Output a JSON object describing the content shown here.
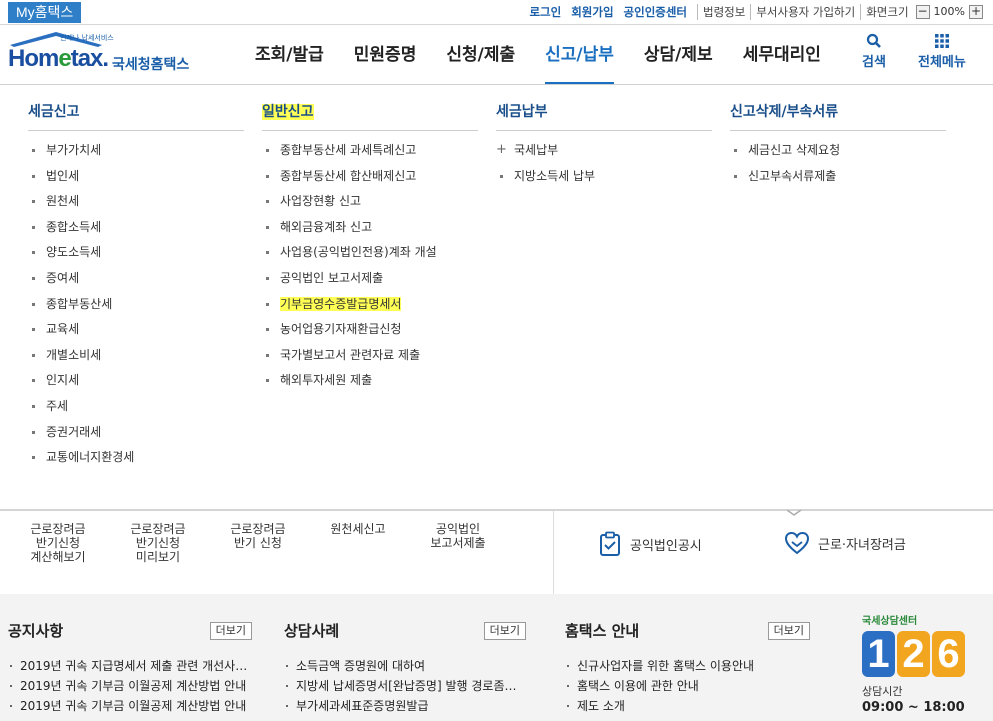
{
  "topbar": {
    "my_hometax": "My홈택스",
    "login": "로그인",
    "signup": "회원가입",
    "cert_center": "공인인증센터",
    "law_info": "법령정보",
    "dept_user_join": "부서사용자 가입하기",
    "screen_size": "화면크기",
    "zoom_minus": "−",
    "zoom_value": "100%",
    "zoom_plus": "+"
  },
  "logo": {
    "tagline": "언제나 납세서비스",
    "brand_pre": "Hom",
    "brand_e": "e",
    "brand_post": "tax.",
    "korean_name": "국세청홈택스"
  },
  "gnb": {
    "items": [
      "조회/발급",
      "민원증명",
      "신청/제출",
      "신고/납부",
      "상담/제보",
      "세무대리인"
    ],
    "active_index": 3,
    "search_label": "검색",
    "all_menu_label": "전체메뉴"
  },
  "dropdown": {
    "col1": {
      "title": "세금신고",
      "items": [
        "부가가치세",
        "법인세",
        "원천세",
        "종합소득세",
        "양도소득세",
        "증여세",
        "종합부동산세",
        "교육세",
        "개별소비세",
        "인지세",
        "주세",
        "증권거래세",
        "교통에너지환경세"
      ]
    },
    "col2": {
      "title": "일반신고",
      "items": [
        "종합부동산세 과세특례신고",
        "종합부동산세 합산배제신고",
        "사업장현황 신고",
        "해외금융계좌 신고",
        "사업용(공익법인전용)계좌 개설",
        "공익법인 보고서제출",
        "기부금영수증발급명세서",
        "농어업용기자재환급신청",
        "국가별보고서 관련자료 제출",
        "해외투자세원 제출"
      ],
      "highlighted_index": 6
    },
    "col3": {
      "title": "세금납부",
      "items": [
        "국세납부",
        "지방소득세 납부"
      ]
    },
    "col4": {
      "title": "신고삭제/부속서류",
      "items": [
        "세금신고 삭제요청",
        "신고부속서류제출"
      ]
    }
  },
  "quick": {
    "items": [
      {
        "l1": "근로장려금",
        "l2": "반기신청",
        "l3": "계산해보기"
      },
      {
        "l1": "근로장려금",
        "l2": "반기신청",
        "l3": "미리보기"
      },
      {
        "l1": "근로장려금",
        "l2": "반기 신청",
        "l3": ""
      },
      {
        "l1": "원천세신고",
        "l2": "",
        "l3": ""
      },
      {
        "l1": "공익법인",
        "l2": "보고서제출",
        "l3": ""
      }
    ],
    "public_corp": "공익법인공시",
    "child_credit": "근로·자녀장려금"
  },
  "boards": {
    "notice": {
      "title": "공지사항",
      "more": "더보기",
      "items": [
        "2019년 귀속 지급명세서 제출 관련 개선사…",
        "2019년 귀속 기부금 이월공제 계산방법 안내",
        "2019년 귀속 기부금 이월공제 계산방법 안내"
      ]
    },
    "cases": {
      "title": "상담사례",
      "more": "더보기",
      "items": [
        "소득금액 증명원에 대하여",
        "지방세 납세증명서[완납증명] 발행 경로좀…",
        "부가세과세표준증명원발급"
      ]
    },
    "guide": {
      "title": "홈택스 안내",
      "more": "더보기",
      "items": [
        "신규사업자를 위한 홈택스 이용안내",
        "홈택스 이용에 관한 안내",
        "제도 소개"
      ]
    }
  },
  "call_center": {
    "title": "국세상담센터",
    "digits": [
      "1",
      "2",
      "6"
    ],
    "colors": [
      "#2b6fc4",
      "#f2a51f",
      "#f2a51f"
    ],
    "hours_label": "상담시간",
    "hours": "09:00 ~ 18:00"
  },
  "colors": {
    "accent": "#1a6fc0",
    "highlight": "#ffff55"
  }
}
